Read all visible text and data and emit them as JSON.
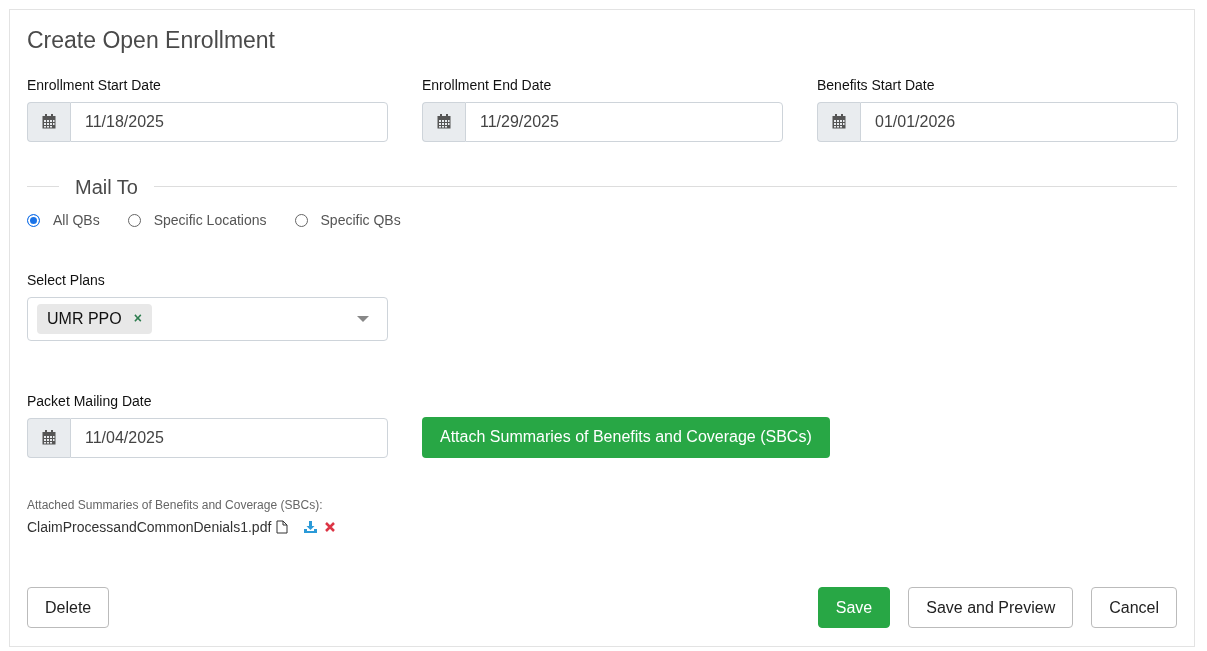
{
  "title": "Create Open Enrollment",
  "date_fields": [
    {
      "label": "Enrollment Start Date",
      "value": "11/18/2025"
    },
    {
      "label": "Enrollment End Date",
      "value": "11/29/2025"
    },
    {
      "label": "Benefits Start Date",
      "value": "01/01/2026"
    }
  ],
  "mail_to": {
    "legend": "Mail To",
    "options": [
      {
        "label": "All QBs",
        "selected": true
      },
      {
        "label": "Specific Locations",
        "selected": false
      },
      {
        "label": "Specific QBs",
        "selected": false
      }
    ]
  },
  "select_plans": {
    "label": "Select Plans",
    "tags": [
      {
        "label": "UMR PPO",
        "remove": "×"
      }
    ]
  },
  "packet_mailing": {
    "label": "Packet Mailing Date",
    "value": "11/04/2025"
  },
  "attach_button": "Attach Summaries of Benefits and Coverage (SBCs)",
  "attachments": {
    "heading": "Attached Summaries of Benefits and Coverage (SBCs):",
    "files": [
      {
        "name": "ClaimProcessandCommonDenials1.pdf"
      }
    ]
  },
  "footer_left": [
    {
      "label": "Delete",
      "kind": "outline"
    }
  ],
  "footer_right": [
    {
      "label": "Save",
      "kind": "success"
    },
    {
      "label": "Save and Preview",
      "kind": "outline"
    },
    {
      "label": "Cancel",
      "kind": "outline"
    }
  ]
}
